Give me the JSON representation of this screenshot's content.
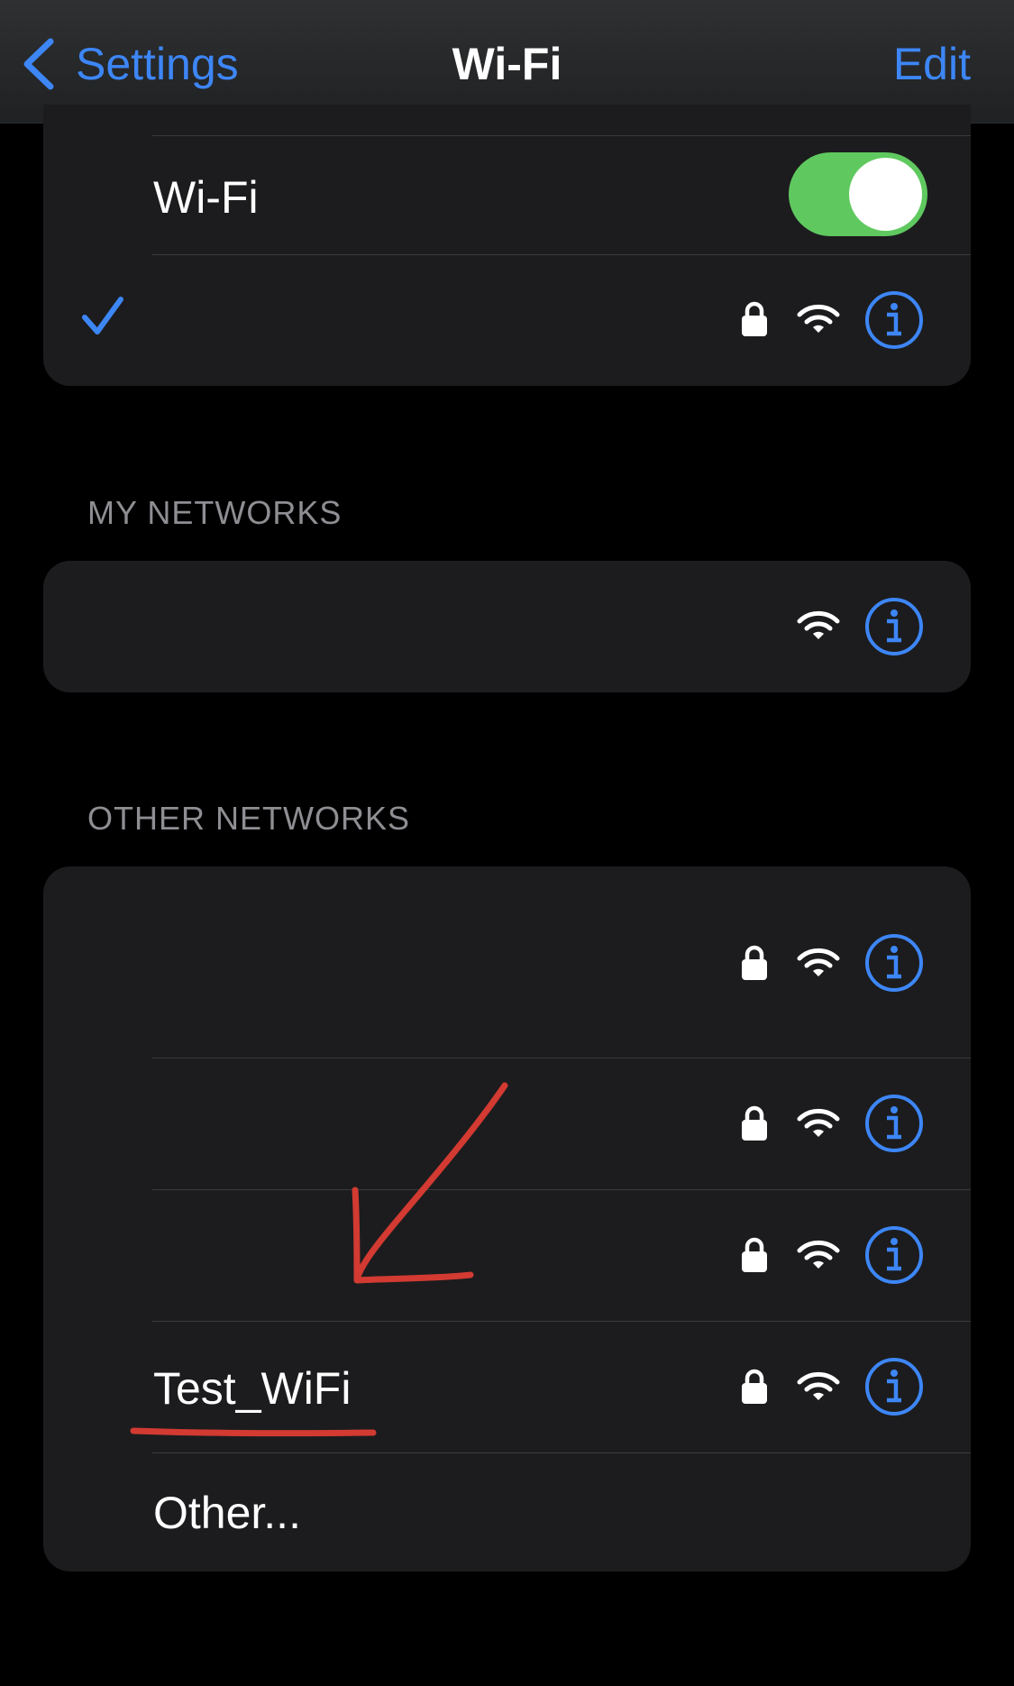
{
  "navbar": {
    "back_label": "Settings",
    "title": "Wi-Fi",
    "edit_label": "Edit"
  },
  "wifi_card": {
    "toggle_label": "Wi-Fi",
    "toggle_on": true,
    "connected_network": {
      "name": "",
      "secured": true,
      "connected": true
    }
  },
  "my_networks": {
    "header": "MY NETWORKS",
    "items": [
      {
        "name": "",
        "secured": false
      }
    ]
  },
  "other_networks": {
    "header": "OTHER NETWORKS",
    "items": [
      {
        "name": "",
        "secured": true
      },
      {
        "name": "",
        "secured": true
      },
      {
        "name": "",
        "secured": true
      },
      {
        "name": "Test_WiFi",
        "secured": true
      }
    ],
    "other_label": "Other..."
  },
  "colors": {
    "accent": "#3d86f6",
    "toggle_on": "#5fc95f",
    "card_bg": "#1c1c1e",
    "annotation": "#d23a32"
  },
  "icons": [
    "chevron-left-icon",
    "checkmark-icon",
    "lock-icon",
    "wifi-icon",
    "info-icon"
  ]
}
